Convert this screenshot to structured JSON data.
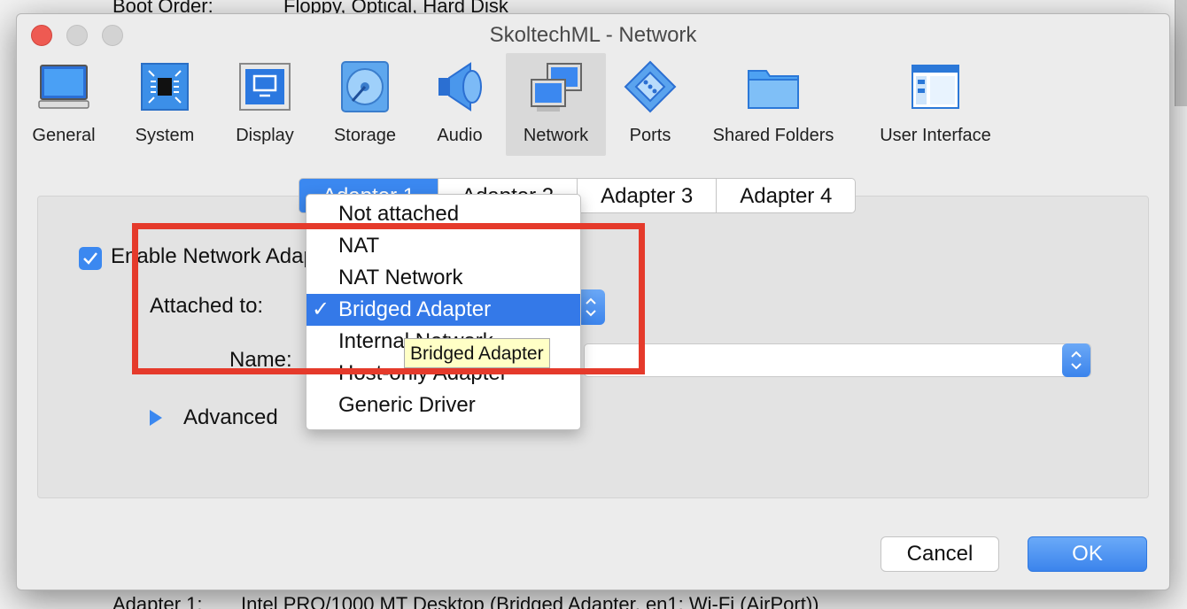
{
  "background": {
    "boot_order_label": "Boot Order:",
    "boot_order_value": "Floppy, Optical, Hard Disk",
    "adapter_summary_label": "Adapter 1:",
    "adapter_summary_value": "Intel PRO/1000 MT Desktop (Bridged Adapter, en1: Wi-Fi (AirPort))"
  },
  "window": {
    "title": "SkoltechML - Network"
  },
  "toolbar": {
    "items": [
      {
        "label": "General",
        "icon": "monitor-icon"
      },
      {
        "label": "System",
        "icon": "chip-icon"
      },
      {
        "label": "Display",
        "icon": "display-icon"
      },
      {
        "label": "Storage",
        "icon": "disk-icon"
      },
      {
        "label": "Audio",
        "icon": "speaker-icon"
      },
      {
        "label": "Network",
        "icon": "network-icon",
        "active": true
      },
      {
        "label": "Ports",
        "icon": "serial-port-icon"
      },
      {
        "label": "Shared Folders",
        "icon": "folder-icon"
      },
      {
        "label": "User Interface",
        "icon": "window-layout-icon"
      }
    ]
  },
  "tabs": [
    {
      "label": "Adapter 1",
      "selected": true
    },
    {
      "label": "Adapter 2"
    },
    {
      "label": "Adapter 3"
    },
    {
      "label": "Adapter 4"
    }
  ],
  "form": {
    "enable_label": "Enable Network Adapter",
    "enable_checked": true,
    "attached_to_label": "Attached to:",
    "name_label": "Name:",
    "advanced_label": "Advanced"
  },
  "dropdown": {
    "options": [
      "Not attached",
      "NAT",
      "NAT Network",
      "Bridged Adapter",
      "Internal Network",
      "Host-only Adapter",
      "Generic Driver"
    ],
    "selected": "Bridged Adapter",
    "check_mark": "✓"
  },
  "tooltip": "Bridged Adapter",
  "buttons": {
    "cancel": "Cancel",
    "ok": "OK"
  },
  "colors": {
    "accent": "#3b88f0",
    "annotation": "#e53a2b"
  }
}
